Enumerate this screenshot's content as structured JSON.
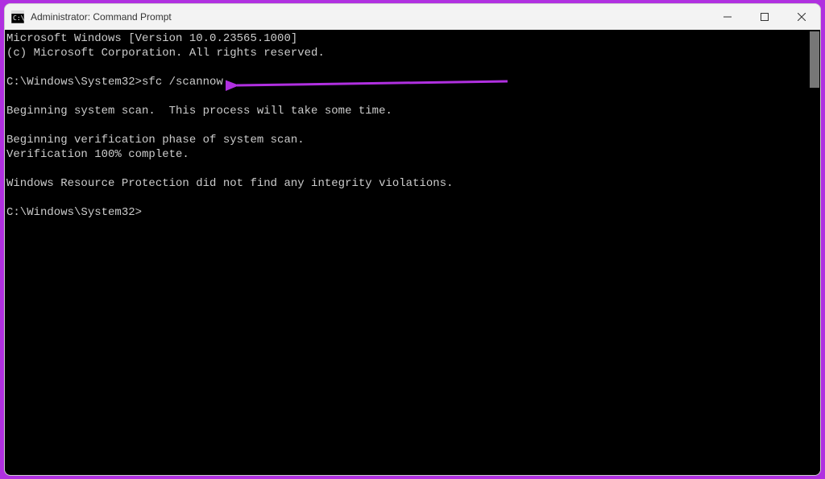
{
  "window": {
    "title": "Administrator: Command Prompt",
    "controls": {
      "minimize": "Minimize",
      "maximize": "Maximize",
      "close": "Close"
    }
  },
  "terminal": {
    "lines": [
      "Microsoft Windows [Version 10.0.23565.1000]",
      "(c) Microsoft Corporation. All rights reserved.",
      "",
      "C:\\Windows\\System32>sfc /scannow",
      "",
      "Beginning system scan.  This process will take some time.",
      "",
      "Beginning verification phase of system scan.",
      "Verification 100% complete.",
      "",
      "Windows Resource Protection did not find any integrity violations.",
      "",
      "C:\\Windows\\System32>"
    ]
  },
  "annotation": {
    "arrow_color": "#b030e0"
  }
}
